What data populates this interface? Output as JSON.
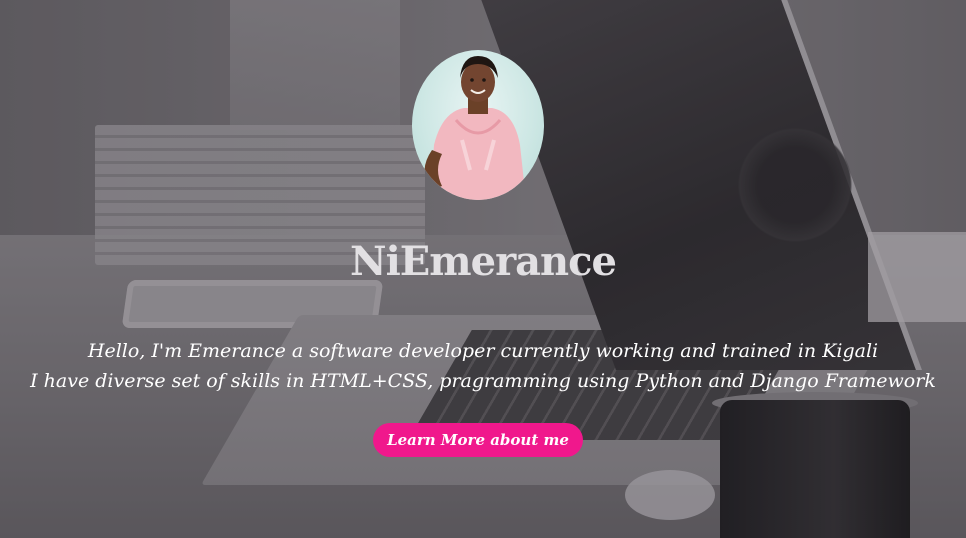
{
  "hero": {
    "title": "NiEmerance",
    "intro_line_1": "Hello, I'm Emerance a software developer currently working and trained in Kigali",
    "intro_line_2": "I have diverse set of skills in HTML+CSS, pragramming using Python and Django Framework",
    "cta_label": "Learn More about me"
  },
  "colors": {
    "accent": "#f0188c",
    "title": "#e2e0e3",
    "text": "#ffffff"
  }
}
